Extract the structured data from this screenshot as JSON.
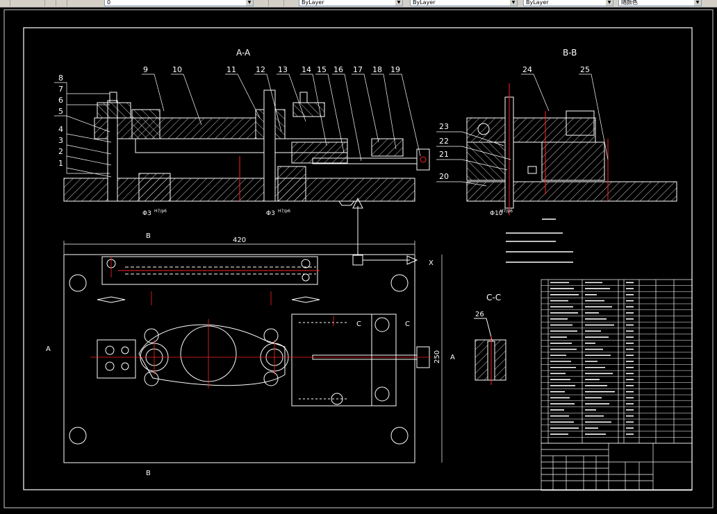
{
  "toolbar": {
    "layer_value": "0",
    "color_value": "ByLayer",
    "linetype_value": "ByLayer",
    "lineweight_value": "ByLayer",
    "plotstyle_value": "随颜色"
  },
  "drawing": {
    "sections": {
      "aa": "A-A",
      "bb": "B-B",
      "cc": "C-C"
    },
    "balloons_aa": [
      "1",
      "2",
      "3",
      "4",
      "5",
      "6",
      "7",
      "8",
      "9",
      "10",
      "11",
      "12",
      "13",
      "14",
      "15",
      "16",
      "17",
      "18",
      "19"
    ],
    "balloons_bb": [
      "20",
      "21",
      "22",
      "23",
      "24",
      "25"
    ],
    "balloon_cc": "26",
    "dims": {
      "width": "420",
      "height": "250",
      "phi3a": "Φ3",
      "phi3b": "Φ3",
      "phi10": "Φ10",
      "fit": "H7/p6"
    },
    "markers": {
      "b_top": "B",
      "b_bottom": "B",
      "a_left": "A",
      "a_right": "A",
      "c_left": "C",
      "c_right": "C",
      "x": "X"
    }
  },
  "colors": {
    "outline": "#ffffff",
    "center": "#ff2020",
    "hatch": "#ffffff",
    "background": "#000000"
  }
}
